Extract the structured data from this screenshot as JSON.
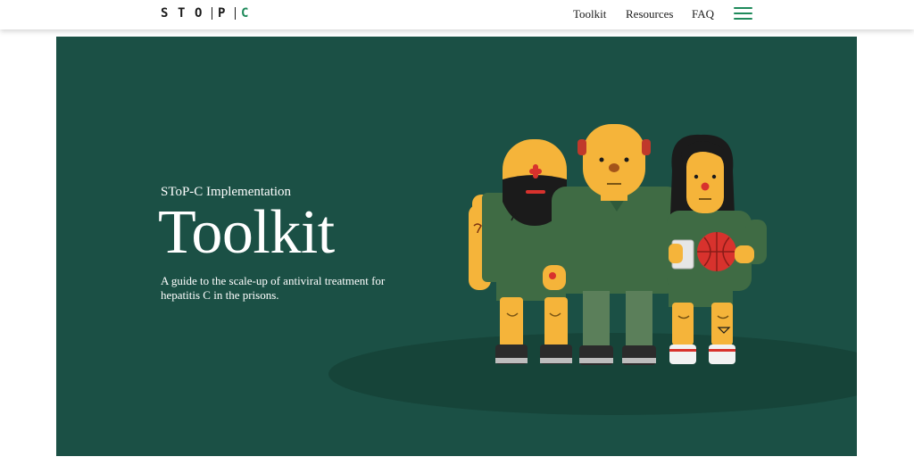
{
  "header": {
    "logo_letters": [
      "S",
      "T",
      "O",
      "P",
      "C"
    ],
    "nav": [
      {
        "label": "Toolkit"
      },
      {
        "label": "Resources"
      },
      {
        "label": "FAQ"
      }
    ],
    "menu_icon": "hamburger-menu-icon"
  },
  "hero": {
    "kicker": "SToP-C Implementation",
    "title": "Toolkit",
    "description": "A guide to the scale-up of antiviral treatment for hepatitis C in the prisons.",
    "illustration": "three-people-illustration"
  },
  "colors": {
    "hero_background": "#1b5045",
    "accent_green": "#1f8a5b",
    "skin": "#f5b43a",
    "shirt": "#3f6b44",
    "red": "#d8322d"
  }
}
